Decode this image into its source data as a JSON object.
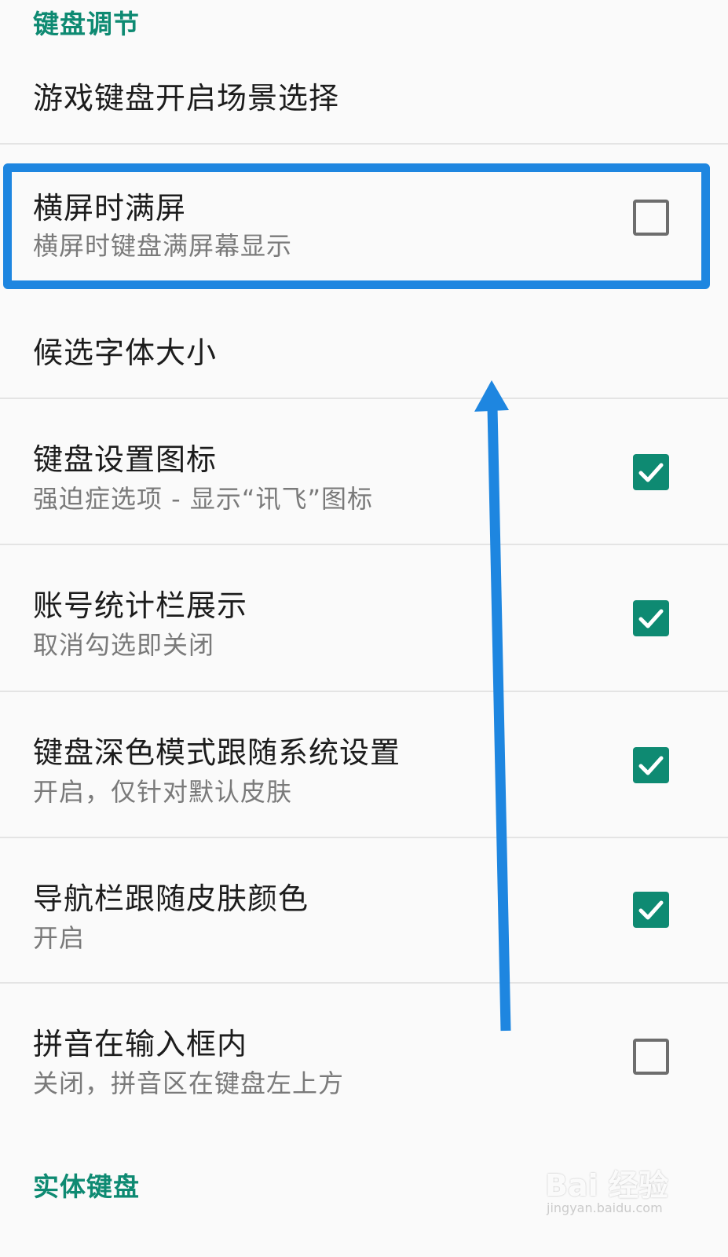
{
  "section_keyboard_adjust": "键盘调节",
  "game_keyboard_scene": "游戏键盘开启场景选择",
  "settings": [
    {
      "title": "横屏时满屏",
      "subtitle": "横屏时键盘满屏幕显示",
      "checked": false
    },
    {
      "title": "候选字体大小",
      "subtitle": "",
      "checked": null
    },
    {
      "title": "键盘设置图标",
      "subtitle": "强迫症选项 - 显示“讯飞”图标",
      "checked": true
    },
    {
      "title": "账号统计栏展示",
      "subtitle": "取消勾选即关闭",
      "checked": true
    },
    {
      "title": "键盘深色模式跟随系统设置",
      "subtitle": "开启，仅针对默认皮肤",
      "checked": true
    },
    {
      "title": "导航栏跟随皮肤颜色",
      "subtitle": "开启",
      "checked": true
    },
    {
      "title": "拼音在输入框内",
      "subtitle": "关闭，拼音区在键盘左上方",
      "checked": false
    }
  ],
  "section_physical_keyboard": "实体键盘",
  "watermark": {
    "brand": "Bai 经验",
    "url": "jingyan.baidu.com"
  },
  "colors": {
    "accent": "#0e8a72",
    "annotation_blue": "#1e86e0",
    "divider": "#e4e4e4"
  },
  "icons": {
    "checked": "checkmark-icon",
    "annotation_arrow": "arrow-up-icon"
  }
}
